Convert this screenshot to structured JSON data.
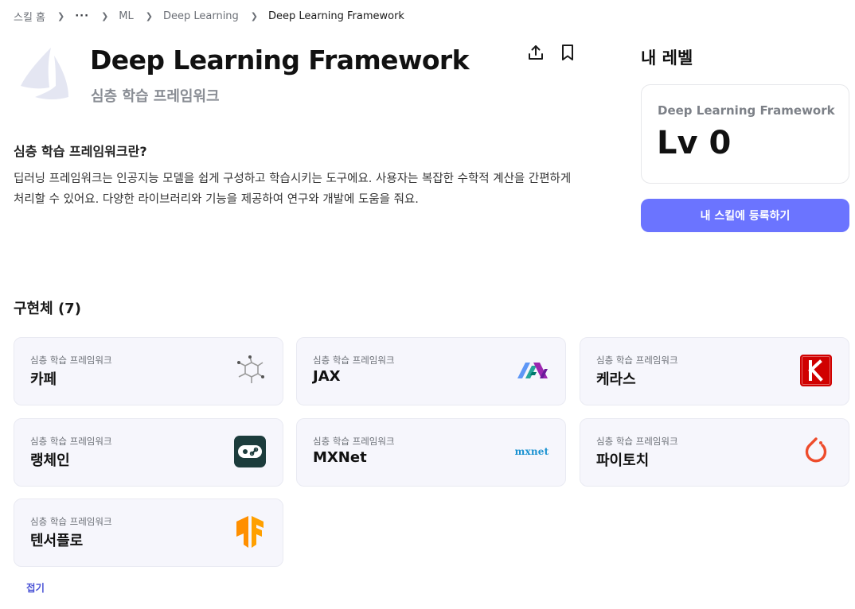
{
  "breadcrumb": {
    "home": "스킬 홈",
    "more": "···",
    "ml": "ML",
    "parent": "Deep Learning",
    "current": "Deep Learning Framework"
  },
  "skill": {
    "title": "Deep Learning Framework",
    "subtitle": "심층 학습 프레임워크",
    "logo_icon": "sail-icon"
  },
  "about": {
    "heading": "심층 학습 프레임워크란?",
    "body": "딥러닝 프레임워크는 인공지능 모델을 쉽게 구성하고 학습시키는 도구에요. 사용자는 복잡한 수학적 계산을 간편하게 처리할 수 있어요. 다양한 라이브러리와 기능을 제공하여 연구와 개발에 도움을 줘요."
  },
  "level": {
    "heading": "내 레벨",
    "skill_name": "Deep Learning Framework",
    "value": "Lv 0",
    "register_label": "내 스킬에 등록하기"
  },
  "implementations": {
    "heading": "구현체 (7)",
    "items": [
      {
        "category": "심층 학습 프레임워크",
        "name": "카페",
        "icon": "caffe-molecule-icon"
      },
      {
        "category": "심층 학습 프레임워크",
        "name": "JAX",
        "icon": "jax-icon"
      },
      {
        "category": "심층 학습 프레임워크",
        "name": "케라스",
        "icon": "keras-icon"
      },
      {
        "category": "심층 학습 프레임워크",
        "name": "랭체인",
        "icon": "langchain-icon"
      },
      {
        "category": "심층 학습 프레임워크",
        "name": "MXNet",
        "icon": "mxnet-icon",
        "logo_text": "mxnet"
      },
      {
        "category": "심층 학습 프레임워크",
        "name": "파이토치",
        "icon": "pytorch-icon"
      },
      {
        "category": "심층 학습 프레임워크",
        "name": "텐서플로",
        "icon": "tensorflow-icon"
      }
    ],
    "collapse_label": "접기"
  },
  "colors": {
    "accent": "#6b74ff",
    "link": "#4c55d6",
    "card_bg": "#f6f6fc",
    "keras_red": "#d00000",
    "pytorch_orange": "#ee4c2c",
    "tensorflow_orange": "#ff8f00",
    "langchain_green": "#1c3c3c",
    "mxnet_blue": "#1b92d1"
  }
}
